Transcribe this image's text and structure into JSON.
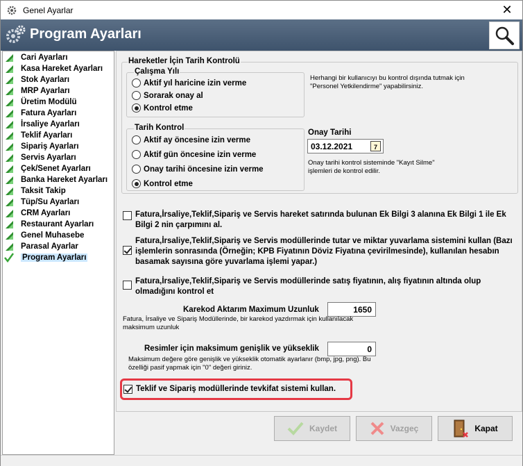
{
  "window": {
    "title": "Genel Ayarlar",
    "close_glyph": "✕",
    "icon": "gear-app-icon"
  },
  "header": {
    "title": "Program Ayarları",
    "search_icon": "magnifier-icon"
  },
  "sidebar": {
    "items": [
      {
        "label": "Cari Ayarları"
      },
      {
        "label": "Kasa Hareket Ayarları"
      },
      {
        "label": "Stok Ayarları"
      },
      {
        "label": "MRP Ayarları"
      },
      {
        "label": "Üretim Modülü"
      },
      {
        "label": "Fatura Ayarları"
      },
      {
        "label": "İrsaliye Ayarları"
      },
      {
        "label": "Teklif Ayarları"
      },
      {
        "label": "Sipariş Ayarları"
      },
      {
        "label": "Servis Ayarları"
      },
      {
        "label": "Çek/Senet Ayarları"
      },
      {
        "label": "Banka Hareket Ayarları"
      },
      {
        "label": "Taksit Takip"
      },
      {
        "label": "Tüp/Su Ayarları"
      },
      {
        "label": "CRM Ayarları"
      },
      {
        "label": "Restaurant Ayarları"
      },
      {
        "label": "Genel Muhasebe"
      },
      {
        "label": "Parasal Ayarlar"
      },
      {
        "label": "Program Ayarları",
        "selected": true
      }
    ]
  },
  "date_control": {
    "group_title": "Hareketler İçin Tarih Kontrolü",
    "period": {
      "title": "Çalışma Yılı",
      "options": [
        "Aktif yıl haricine izin verme",
        "Sorarak onay al",
        "Kontrol etme"
      ],
      "selected": "Kontrol etme"
    },
    "period_note": "Herhangi bir kullanıcıyı bu kontrol dışında tutmak için \"Personel Yetkilendirme\" yapabilirsiniz.",
    "date": {
      "title": "Tarih Kontrol",
      "options": [
        "Aktif ay öncesine izin verme",
        "Aktif gün öncesine izin verme",
        "Onay tarihi öncesine izin verme",
        "Kontrol etme"
      ],
      "selected": "Kontrol etme"
    },
    "approval": {
      "label": "Onay Tarihi",
      "value": "03.12.2021",
      "calendar_icon": "calendar-icon",
      "calendar_day": "7",
      "note": "Onay tarihi kontrol sisteminde \"Kayıt Silme\" işlemleri de kontrol edilir."
    }
  },
  "options": [
    {
      "text": "Fatura,İrsaliye,Teklif,Sipariş ve Servis hareket satırında bulunan Ek Bilgi 3 alanına Ek Bilgi 1 ile Ek Bilgi 2 nin çarpımını al.",
      "checked": false
    },
    {
      "text": "Fatura,İrsaliye,Teklif,Sipariş ve Servis modüllerinde tutar ve miktar yuvarlama sistemini kullan (Bazı işlemlerin sonrasında (Örneğin; KPB Fiyatının Döviz Fiyatına çevirilmesinde), kullanılan hesabın basamak sayısına göre yuvarlama işlemi yapar.)",
      "checked": true
    },
    {
      "text": "Fatura,İrsaliye,Teklif,Sipariş ve Servis modüllerinde satış fiyatının, alış fiyatının altında olup olmadığını kontrol et",
      "checked": false
    }
  ],
  "barcode": {
    "label": "Karekod Aktarım Maximum Uzunluk",
    "value": "1650",
    "note": "Fatura, İrsaliye ve Sipariş Modüllerinde, bir karekod yazdırmak için kullanılacak maksimum uzunluk"
  },
  "images": {
    "label": "Resimler için maksimum genişlik ve yükseklik",
    "value": "0",
    "note": "Maksimum değere göre genişlik ve yükseklik otomatik ayarlanır (bmp, jpg, png). Bu özelliği pasif yapmak için \"0\" değeri giriniz."
  },
  "withholding": {
    "text": "Teklif ve Sipariş modüllerinde tevkifat sistemi kullan.",
    "checked": true
  },
  "buttons": {
    "save": {
      "label": "Kaydet",
      "enabled": false,
      "icon": "checkmark-icon"
    },
    "cancel": {
      "label": "Vazgeç",
      "enabled": false,
      "icon": "x-icon"
    },
    "close": {
      "label": "Kapat",
      "enabled": true,
      "icon": "door-exit-icon"
    }
  },
  "colors": {
    "header_bg": "#4a5f78",
    "highlight": "#e53945",
    "selected_item_bg": "#cce8ff"
  }
}
